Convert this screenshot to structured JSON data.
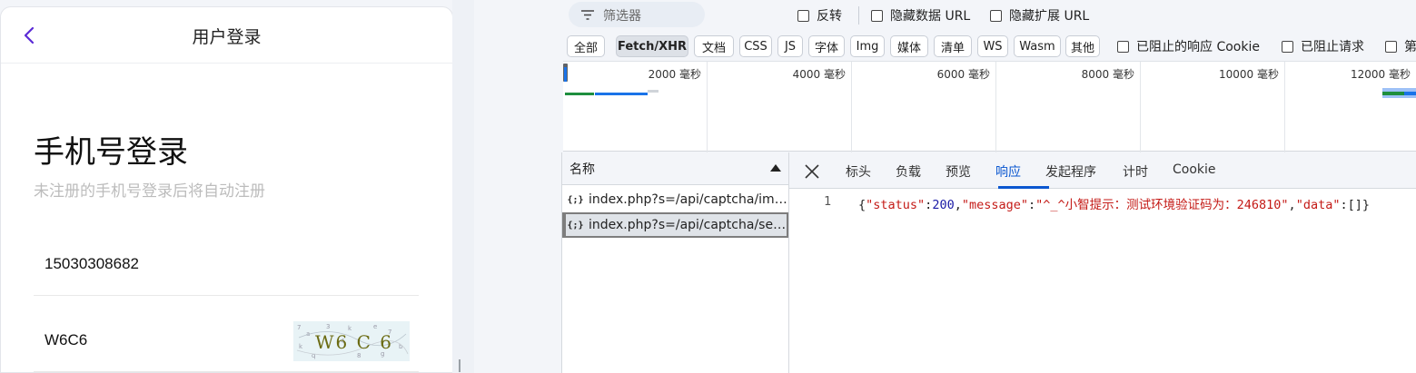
{
  "login_page": {
    "title": "用户登录",
    "heading": "手机号登录",
    "subtitle": "未注册的手机号登录后将自动注册",
    "phone_value": "15030308682",
    "code_value": "W6C6",
    "captcha_text": "W6 C 6"
  },
  "devtools": {
    "filter": {
      "placeholder": "筛选器",
      "checks": [
        "反转",
        "隐藏数据 URL",
        "隐藏扩展 URL"
      ]
    },
    "type_filters": [
      "全部",
      "Fetch/XHR",
      "文档",
      "CSS",
      "JS",
      "字体",
      "Img",
      "媒体",
      "清单",
      "WS",
      "Wasm",
      "其他"
    ],
    "active_type": "Fetch/XHR",
    "type_checks": [
      "已阻止的响应 Cookie",
      "已阻止请求",
      "第"
    ],
    "timeline_labels": [
      "2000 毫秒",
      "4000 毫秒",
      "6000 毫秒",
      "8000 毫秒",
      "10000 毫秒",
      "12000 毫秒"
    ],
    "name_header": "名称",
    "requests": [
      {
        "icon": "{;}",
        "name": "index.php?s=/api/captcha/ima..."
      },
      {
        "icon": "{;}",
        "name": "index.php?s=/api/captcha/sen..."
      }
    ],
    "detail_tabs": [
      "标头",
      "负载",
      "预览",
      "响应",
      "发起程序",
      "计时",
      "Cookie"
    ],
    "active_tab": "响应",
    "response": {
      "line_number": "1",
      "open": "{",
      "k1": "\"status\"",
      "colon1": ":",
      "v1": "200",
      "comma1": ",",
      "k2": "\"message\"",
      "colon2": ":",
      "v2": "\"^_^小智提示：测试环境验证码为：246810\"",
      "comma2": ",",
      "k3": "\"data\"",
      "colon3": ":",
      "v3": "[]",
      "close": "}"
    }
  },
  "colors": {
    "accent": "#0b57d0",
    "back_arrow": "#5b2bd6",
    "json_key": "#c41a16",
    "json_number": "#1a1aa6"
  }
}
